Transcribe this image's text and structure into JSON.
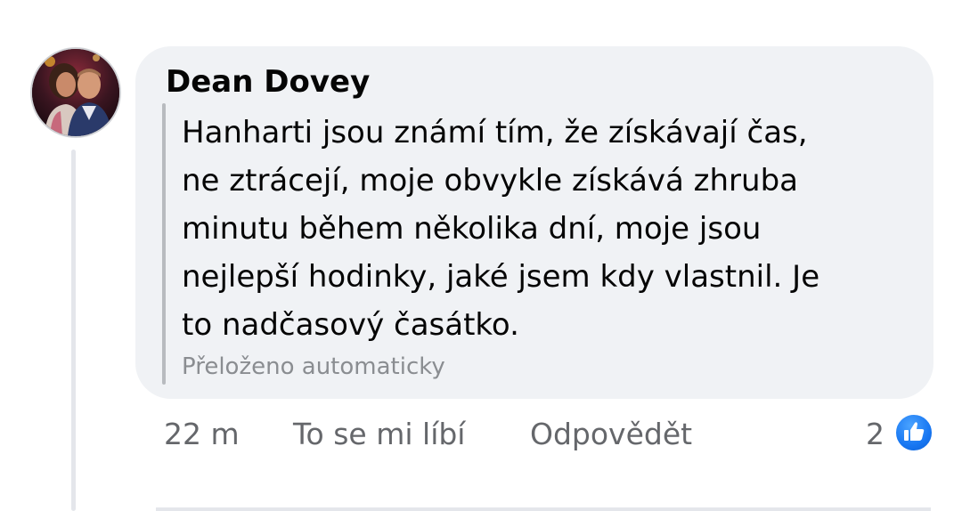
{
  "comment": {
    "author": "Dean Dovey",
    "text_lines": [
      "Hanharti jsou známí tím, že získávají čas,",
      "ne ztrácejí, moje obvykle získává zhruba",
      "minutu během několika dní, moje jsou",
      "nejlepší hodinky, jaké jsem kdy vlastnil. Je",
      "to nadčasový časátko."
    ],
    "translation_note": "Přeloženo automaticky",
    "avatar_icon": "profile-photo"
  },
  "actions": {
    "timestamp": "22 m",
    "like_label": "To se mi líbí",
    "reply_label": "Odpovědět",
    "reaction_count": "2",
    "reaction_icon": "thumbs-up-icon"
  },
  "colors": {
    "bubble_bg": "#f0f2f5",
    "text": "#050505",
    "secondary_text": "#65676b",
    "muted_text": "#8a8d91",
    "like_blue": "#1877f2"
  }
}
